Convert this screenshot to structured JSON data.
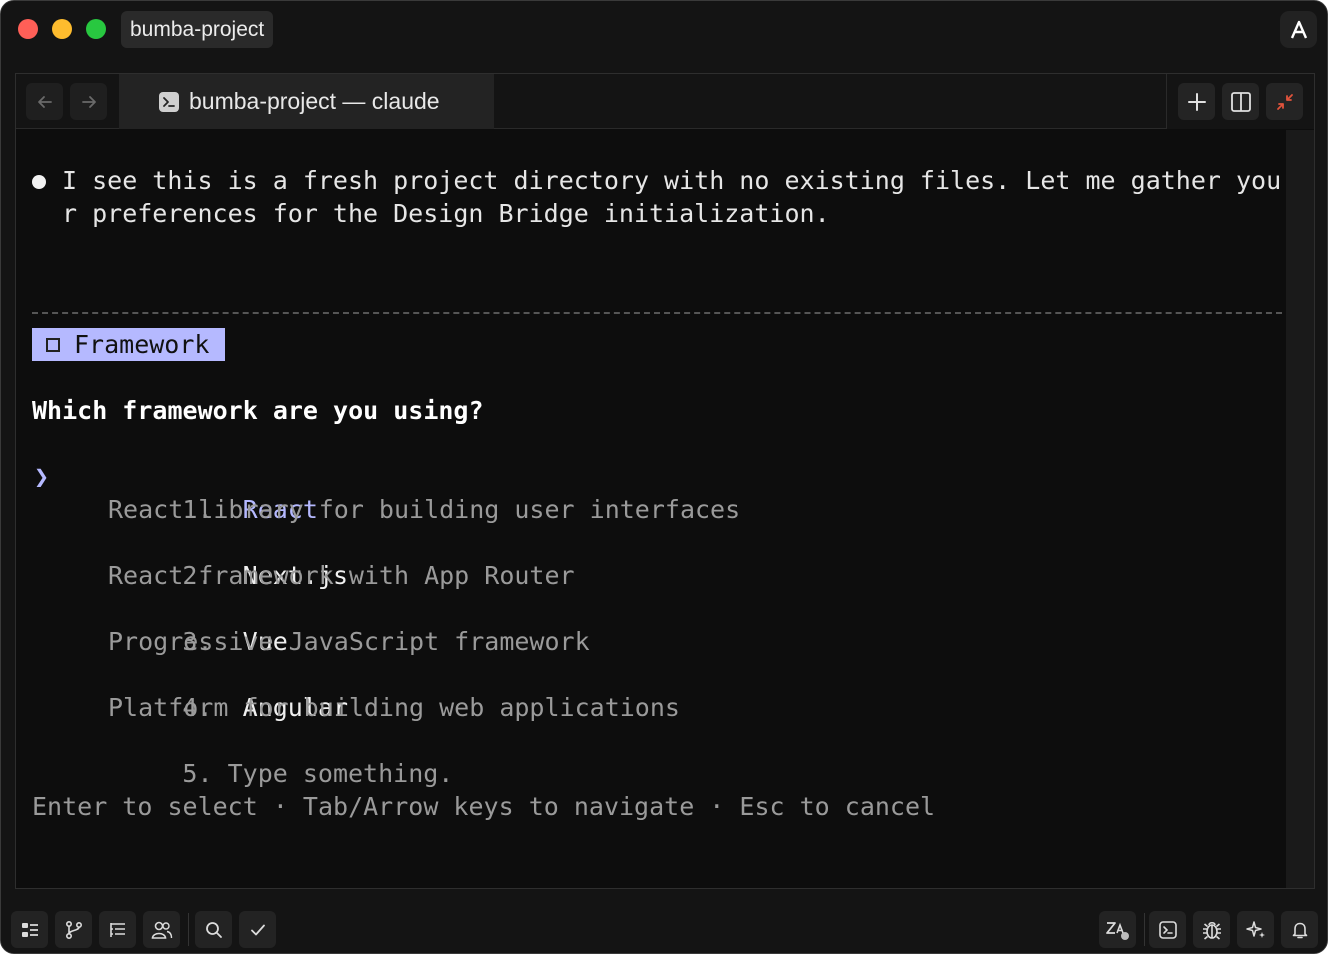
{
  "window": {
    "project_name": "bumba-project",
    "account_initial": "A"
  },
  "tab": {
    "title": "bumba-project — claude"
  },
  "terminal": {
    "intro": "I see this is a fresh project directory with no existing files. Let me gather your preferences for the Design Bridge initialization.",
    "header_label": "Framework",
    "question": "Which framework are you using?",
    "pointer": "❯",
    "options": [
      {
        "number": "1.",
        "label": "React",
        "description": "React library for building user interfaces"
      },
      {
        "number": "2.",
        "label": "Next.js",
        "description": "React framework with App Router"
      },
      {
        "number": "3.",
        "label": "Vue",
        "description": "Progressive JavaScript framework"
      },
      {
        "number": "4.",
        "label": "Angular",
        "description": "Platform for building web applications"
      },
      {
        "number": "5.",
        "label": "Type something."
      }
    ],
    "hint": "Enter to select · Tab/Arrow keys to navigate · Esc to cancel"
  },
  "icons": {
    "left": [
      "tree-icon",
      "branch-icon",
      "outline-icon",
      "users-icon",
      "search-icon",
      "check-icon"
    ],
    "right": [
      "translate-icon",
      "terminal-icon",
      "bug-icon",
      "sparkle-icon",
      "bell-icon"
    ]
  },
  "colors": {
    "accent": "#b5b9ff",
    "background": "#0d0d0d",
    "muted_text": "#9a9a9a",
    "traffic_red": "#ff5f57",
    "traffic_yellow": "#febc2e",
    "traffic_green": "#28c840",
    "collapse_icon": "#e0533c"
  }
}
